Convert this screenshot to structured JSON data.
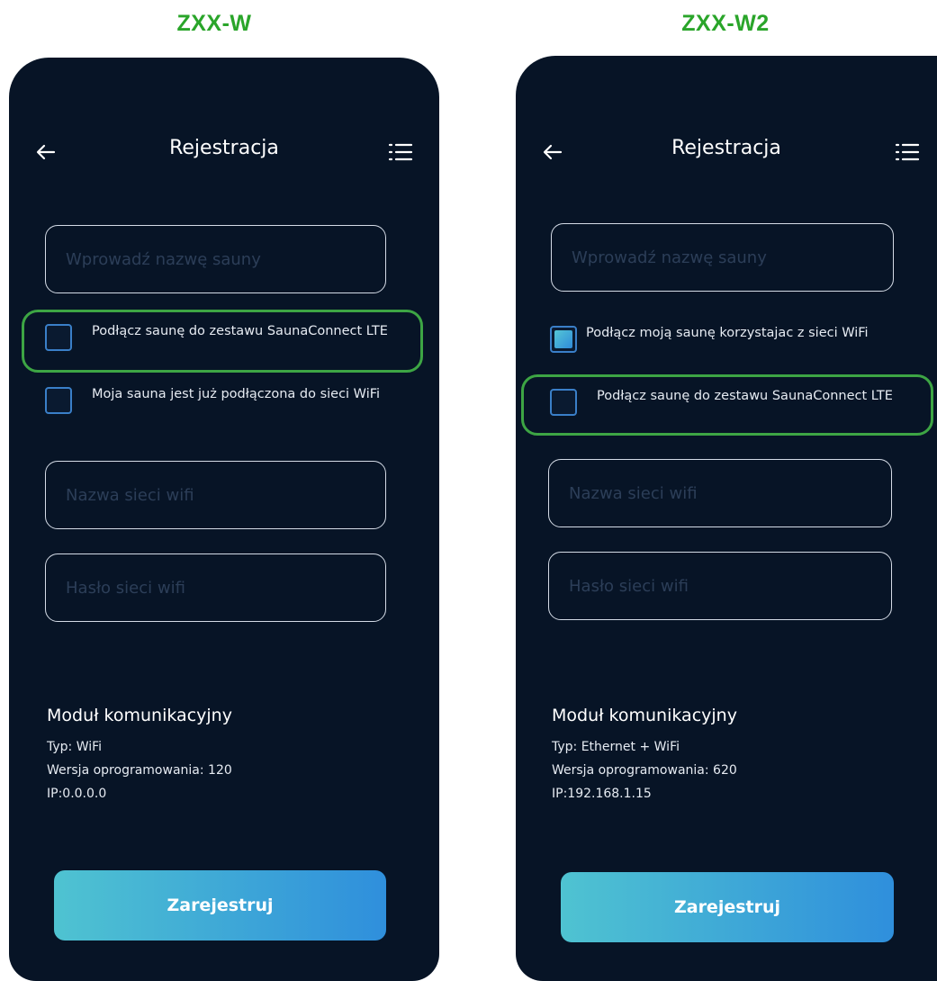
{
  "left": {
    "variant_title": "ZXX-W",
    "screen_title": "Rejestracja",
    "sauna_name_placeholder": "Wprowadź nazwę sauny",
    "option1_label": "Podłącz saunę do zestawu SaunaConnect LTE",
    "option1_checked": false,
    "option2_label": "Moja sauna jest już podłączona do sieci WiFi",
    "option2_checked": false,
    "wifi_name_placeholder": "Nazwa sieci wifi",
    "wifi_password_placeholder": "Hasło sieci wifi",
    "module_title": "Moduł komunikacyjny",
    "module_type": "Typ: WiFi",
    "module_firmware": "Wersja oprogramowania: 120",
    "module_ip": "IP:0.0.0.0",
    "register_label": "Zarejestruj"
  },
  "right": {
    "variant_title": "ZXX-W2",
    "screen_title": "Rejestracja",
    "sauna_name_placeholder": "Wprowadź nazwę sauny",
    "option1_label": "Podłącz moją saunę korzystajac z sieci WiFi",
    "option1_checked": true,
    "option2_label": "Podłącz saunę do zestawu SaunaConnect LTE",
    "option2_checked": false,
    "wifi_name_placeholder": "Nazwa sieci wifi",
    "wifi_password_placeholder": "Hasło sieci wifi",
    "module_title": "Moduł komunikacyjny",
    "module_type": "Typ: Ethernet + WiFi",
    "module_firmware": "Wersja oprogramowania: 620",
    "module_ip": "IP:192.168.1.15",
    "register_label": "Zarejestruj"
  },
  "icons": {
    "back": "arrow-left-icon",
    "menu": "list-menu-icon"
  },
  "colors": {
    "background": "#071426",
    "title_green": "#2aa52a",
    "highlight_green": "#3da544",
    "checkbox_border": "#3a7fc8",
    "button_gradient_start": "#4fc3d1",
    "button_gradient_end": "#2f8fdc"
  }
}
